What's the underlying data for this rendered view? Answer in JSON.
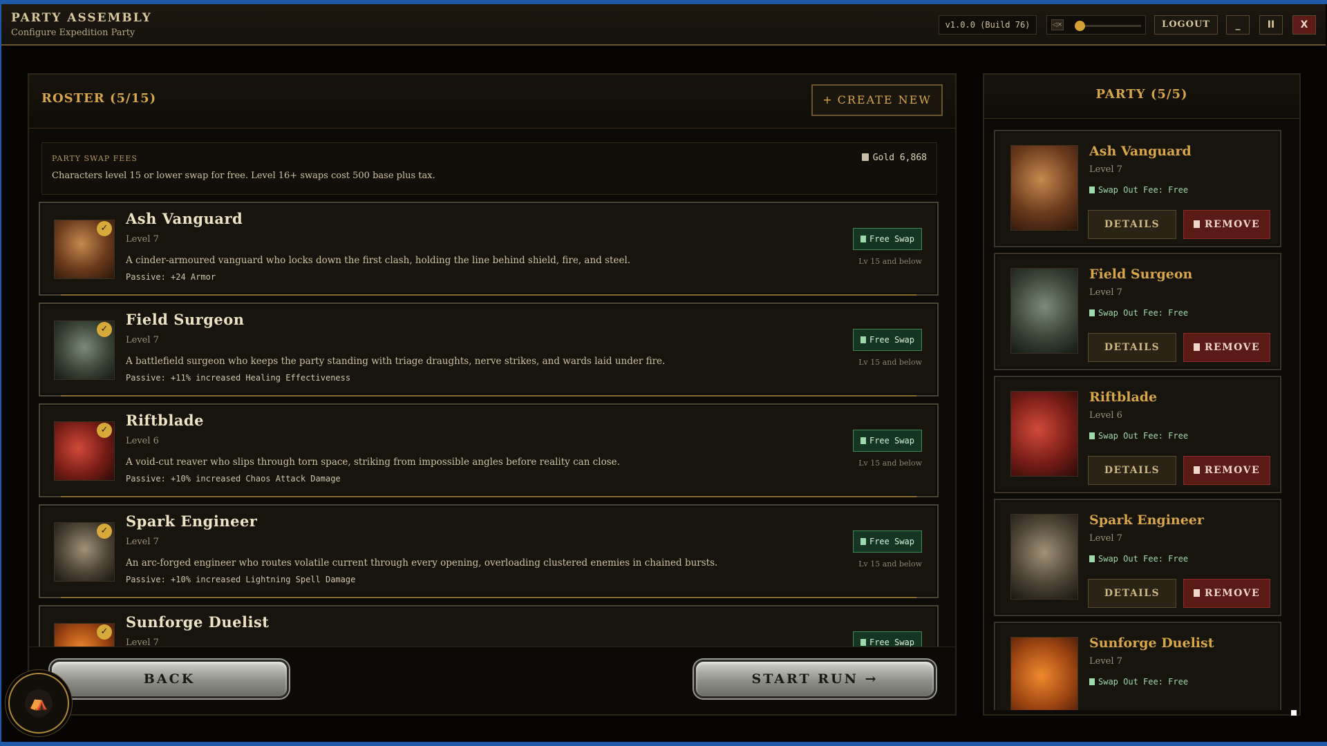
{
  "app": {
    "title": "PARTY ASSEMBLY",
    "subtitle": "Configure Expedition Party",
    "version": "v1.0.0 (Build 76)",
    "logout_label": "LOGOUT",
    "minimize_label": "_",
    "pause_label": "II",
    "close_label": "X",
    "mute_label": "◁×",
    "volume_percent": 0
  },
  "roster": {
    "title": "ROSTER (5/15)",
    "create_label": "CREATE NEW",
    "fees_title": "PARTY SWAP FEES",
    "fees_text": "Characters level 15 or lower swap for free. Level 16+ swaps cost 500 base plus tax.",
    "gold": "Gold 6,868",
    "characters": [
      {
        "name": "Ash Vanguard",
        "level": "Level 7",
        "description": "A cinder-armoured vanguard who locks down the first clash, holding the line behind shield, fire, and steel.",
        "passive": "Passive: +24 Armor",
        "swap": "Free Swap",
        "swap_note": "Lv 15 and below"
      },
      {
        "name": "Field Surgeon",
        "level": "Level 7",
        "description": "A battlefield surgeon who keeps the party standing with triage draughts, nerve strikes, and wards laid under fire.",
        "passive": "Passive: +11% increased Healing Effectiveness",
        "swap": "Free Swap",
        "swap_note": "Lv 15 and below"
      },
      {
        "name": "Riftblade",
        "level": "Level 6",
        "description": "A void-cut reaver who slips through torn space, striking from impossible angles before reality can close.",
        "passive": "Passive: +10% increased Chaos Attack Damage",
        "swap": "Free Swap",
        "swap_note": "Lv 15 and below"
      },
      {
        "name": "Spark Engineer",
        "level": "Level 7",
        "description": "An arc-forged engineer who routes volatile current through every opening, overloading clustered enemies in chained bursts.",
        "passive": "Passive: +10% increased Lightning Spell Damage",
        "swap": "Free Swap",
        "swap_note": "Lv 15 and below"
      },
      {
        "name": "Sunforge Duelist",
        "level": "Level 7",
        "description": "",
        "passive": "",
        "swap": "Free Swap",
        "swap_note": ""
      }
    ],
    "back_label": "BACK",
    "start_label": "START RUN →"
  },
  "party": {
    "title": "PARTY (5/5)",
    "details_label": "DETAILS",
    "remove_label": "REMOVE",
    "members": [
      {
        "name": "Ash Vanguard",
        "level": "Level 7",
        "fee": "Swap Out Fee: Free"
      },
      {
        "name": "Field Surgeon",
        "level": "Level 7",
        "fee": "Swap Out Fee: Free"
      },
      {
        "name": "Riftblade",
        "level": "Level 6",
        "fee": "Swap Out Fee: Free"
      },
      {
        "name": "Spark Engineer",
        "level": "Level 7",
        "fee": "Swap Out Fee: Free"
      },
      {
        "name": "Sunforge Duelist",
        "level": "Level 7",
        "fee": "Swap Out Fee: Free"
      }
    ]
  },
  "icons": {
    "check": "✓",
    "emblem": "⛺"
  },
  "colors": {
    "accent_gold": "#d7a64a",
    "free_green": "#163422",
    "remove_red": "#5a1a16",
    "frame_blue": "#1f5aa8"
  }
}
